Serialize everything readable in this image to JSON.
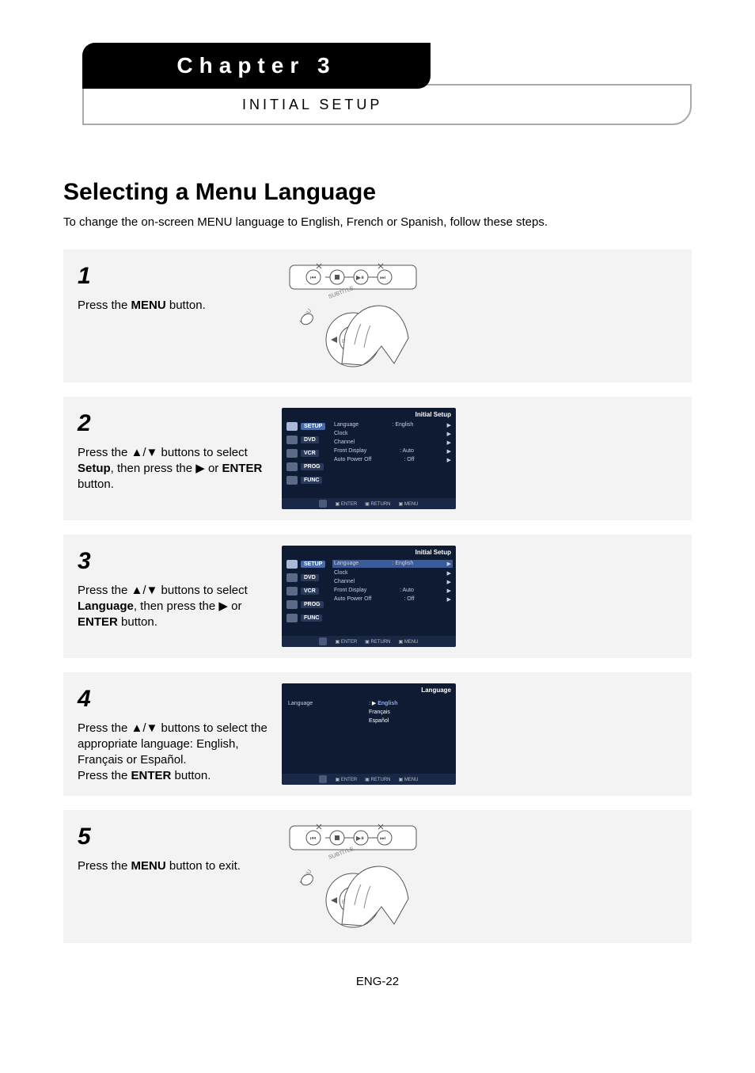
{
  "header": {
    "chapter": "Chapter 3",
    "subtitle": "INITIAL SETUP"
  },
  "section": {
    "title": "Selecting a Menu Language",
    "subtitle": "To change the on-screen MENU language to English, French or Spanish, follow these steps."
  },
  "steps": {
    "s1": {
      "num": "1",
      "a": "Press the ",
      "b": "MENU",
      "c": " button."
    },
    "s2": {
      "num": "2",
      "a": "Press the ▲/▼ buttons to select ",
      "b": "Setup",
      "c": ", then press the ▶ or ",
      "d": "ENTER",
      "e": " button."
    },
    "s3": {
      "num": "3",
      "a": "Press the ▲/▼ buttons to select ",
      "b": "Language",
      "c": ", then press the ▶ or ",
      "d": "ENTER",
      "e": " button."
    },
    "s4": {
      "num": "4",
      "a": "Press the ▲/▼ buttons to select the appropriate language: English, Français or Español.",
      "b": "Press the ",
      "c": "ENTER",
      "d": " button."
    },
    "s5": {
      "num": "5",
      "a": "Press the ",
      "b": "MENU",
      "c": " button to exit."
    }
  },
  "osd": {
    "title": "Initial Setup",
    "tabs": {
      "setup": "SETUP",
      "dvd": "DVD",
      "vcr": "VCR",
      "prog": "PROG",
      "func": "FUNC"
    },
    "rows": {
      "language": "Language",
      "language_val": ": English",
      "clock": "Clock",
      "channel": "Channel",
      "front": "Front Display",
      "front_val": ": Auto",
      "power": "Auto Power Off",
      "power_val": ": Off"
    },
    "legend": {
      "enter": "ENTER",
      "return": "RETURN",
      "menu": "MENU"
    }
  },
  "osd_lang": {
    "title": "Language",
    "label": "Language",
    "opts": {
      "en": "English",
      "fr": "Français",
      "es": "Español"
    }
  },
  "footer": {
    "page": "ENG-22"
  }
}
